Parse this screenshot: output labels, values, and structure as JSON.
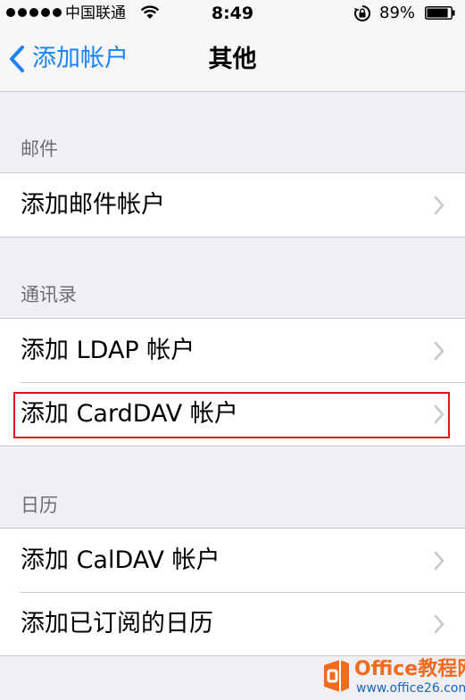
{
  "status_bar": {
    "carrier": "中国联通",
    "time": "8:49",
    "battery_percent": "89%",
    "battery_level": 0.89,
    "signal_bars": 5,
    "icons": [
      "signal-icon",
      "wifi-icon",
      "rotation-lock-icon",
      "battery-icon"
    ]
  },
  "nav": {
    "back_label": "添加帐户",
    "title": "其他"
  },
  "sections": [
    {
      "header": "邮件",
      "rows": [
        {
          "label": "添加邮件帐户"
        }
      ]
    },
    {
      "header": "通讯录",
      "rows": [
        {
          "label": "添加 LDAP 帐户"
        },
        {
          "label": "添加 CardDAV 帐户"
        }
      ]
    },
    {
      "header": "日历",
      "rows": [
        {
          "label": "添加 CalDAV 帐户"
        },
        {
          "label": "添加已订阅的日历"
        }
      ]
    }
  ],
  "watermark": {
    "title": "Office教程网",
    "url": "www.office26.com"
  },
  "colors": {
    "accent": "#1a82fb",
    "background": "#efeff4",
    "highlight": "#e0141e",
    "watermark_orange": "#f26b1d",
    "watermark_blue": "#1565c0"
  }
}
